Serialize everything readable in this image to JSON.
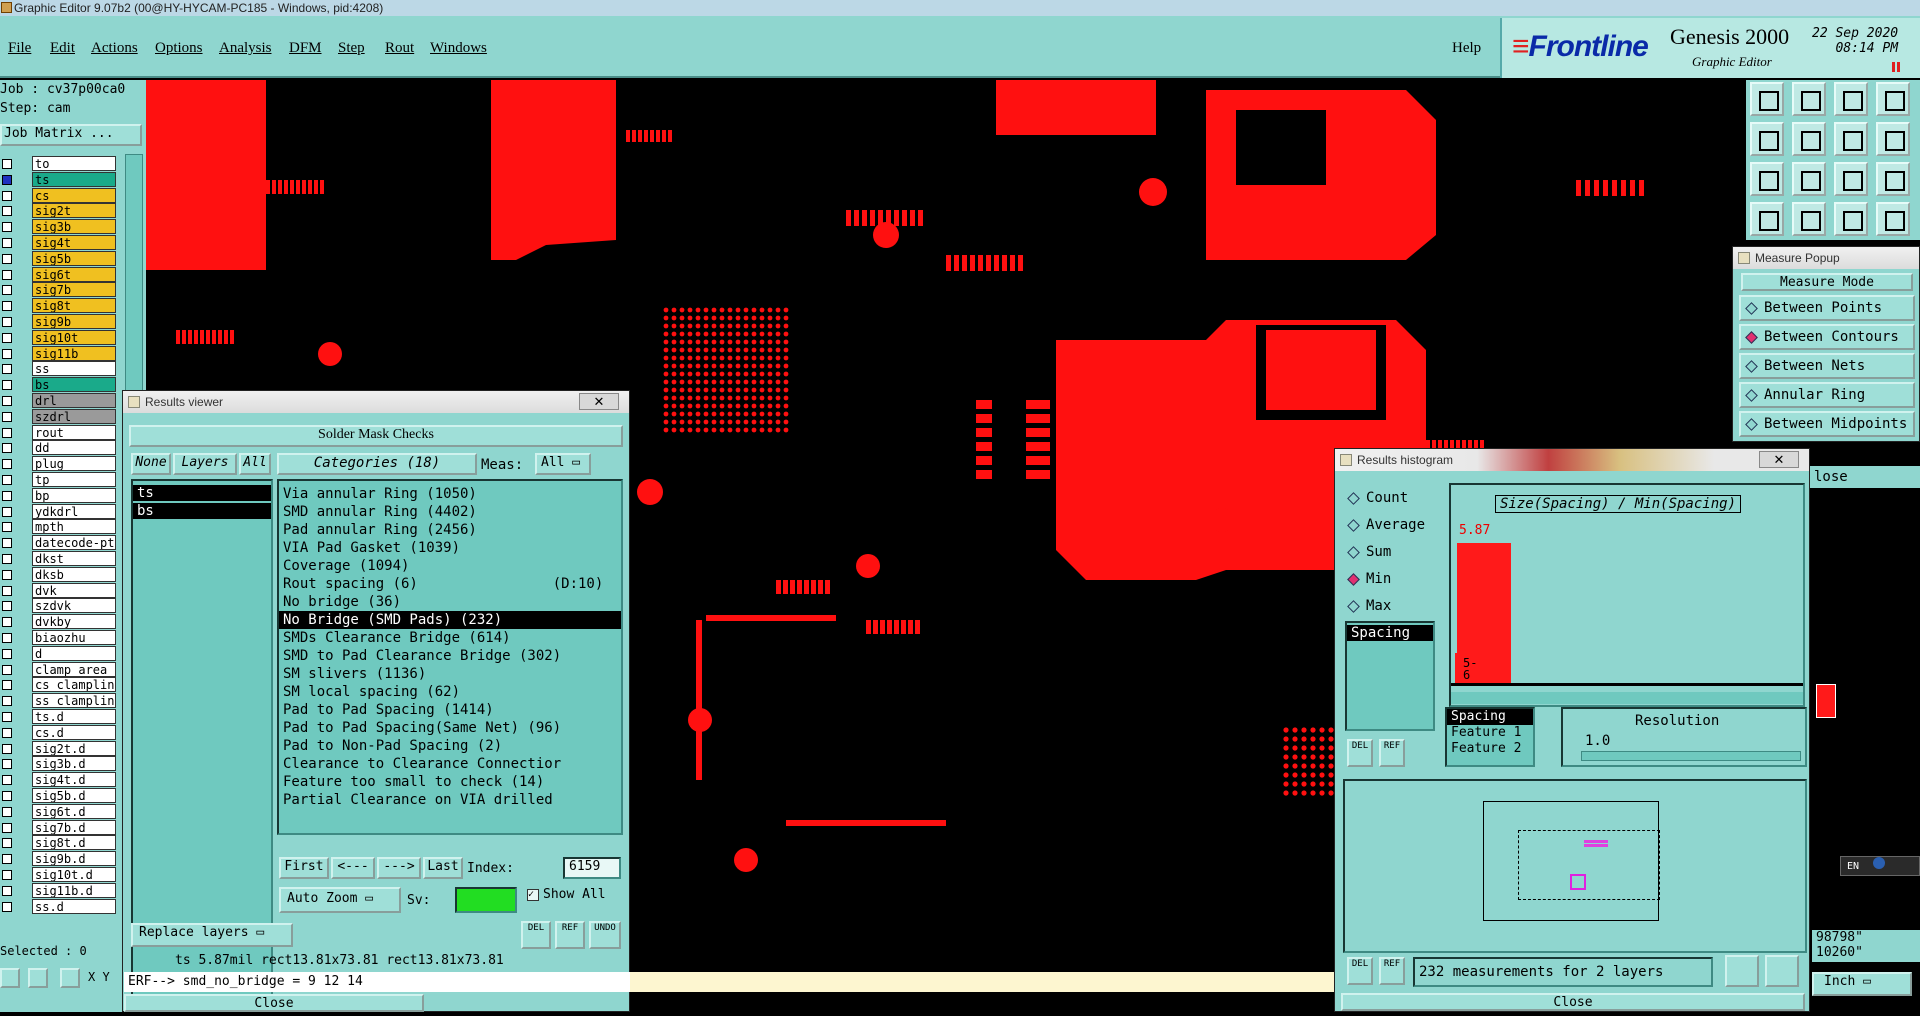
{
  "window": {
    "title": "Graphic Editor 9.07b2 (00@HY-HYCAM-PC185 - Windows, pid:4208)"
  },
  "menu": {
    "items": [
      "File",
      "Edit",
      "Actions",
      "Options",
      "Analysis",
      "DFM",
      "Step",
      "Rout",
      "Windows"
    ],
    "help": "Help"
  },
  "brand": {
    "logo": "Frontline",
    "product": "Genesis 2000",
    "subtitle": "Graphic Editor",
    "date": "22 Sep 2020",
    "time": "08:14 PM"
  },
  "job": {
    "job_line": "Job : cv37p00ca0",
    "step_line": "Step: cam",
    "matrix_button": "Job Matrix ..."
  },
  "layers": [
    {
      "name": "to",
      "color": "#ffffff"
    },
    {
      "name": "ts",
      "color": "#1aaa8a"
    },
    {
      "name": "cs",
      "color": "#f0c020"
    },
    {
      "name": "sig2t",
      "color": "#f0c020"
    },
    {
      "name": "sig3b",
      "color": "#f0c020"
    },
    {
      "name": "sig4t",
      "color": "#f0c020"
    },
    {
      "name": "sig5b",
      "color": "#f0c020"
    },
    {
      "name": "sig6t",
      "color": "#f0c020"
    },
    {
      "name": "sig7b",
      "color": "#f0c020"
    },
    {
      "name": "sig8t",
      "color": "#f0c020"
    },
    {
      "name": "sig9b",
      "color": "#f0c020"
    },
    {
      "name": "sig10t",
      "color": "#f0c020"
    },
    {
      "name": "sig11b",
      "color": "#f0c020"
    },
    {
      "name": "ss",
      "color": "#ffffff"
    },
    {
      "name": "bs",
      "color": "#1aaa8a"
    },
    {
      "name": "drl",
      "color": "#9a9a9a"
    },
    {
      "name": "szdrl",
      "color": "#9a9a9a"
    },
    {
      "name": "rout",
      "color": "#ffffff"
    },
    {
      "name": "dd",
      "color": "#ffffff"
    },
    {
      "name": "plug",
      "color": "#ffffff"
    },
    {
      "name": "tp",
      "color": "#ffffff"
    },
    {
      "name": "bp",
      "color": "#ffffff"
    },
    {
      "name": "ydkdrl",
      "color": "#ffffff"
    },
    {
      "name": "mpth",
      "color": "#ffffff"
    },
    {
      "name": "datecode-ptc",
      "color": "#ffffff"
    },
    {
      "name": "dkst",
      "color": "#ffffff"
    },
    {
      "name": "dksb",
      "color": "#ffffff"
    },
    {
      "name": "dvk",
      "color": "#ffffff"
    },
    {
      "name": "szdvk",
      "color": "#ffffff"
    },
    {
      "name": "dvkby",
      "color": "#ffffff"
    },
    {
      "name": "biaozhu",
      "color": "#ffffff"
    },
    {
      "name": "d",
      "color": "#ffffff"
    },
    {
      "name": "clamp_area",
      "color": "#ffffff"
    },
    {
      "name": "cs_clamplin",
      "color": "#ffffff"
    },
    {
      "name": "ss_clamplin",
      "color": "#ffffff"
    },
    {
      "name": "ts.d",
      "color": "#ffffff"
    },
    {
      "name": "cs.d",
      "color": "#ffffff"
    },
    {
      "name": "sig2t.d",
      "color": "#ffffff"
    },
    {
      "name": "sig3b.d",
      "color": "#ffffff"
    },
    {
      "name": "sig4t.d",
      "color": "#ffffff"
    },
    {
      "name": "sig5b.d",
      "color": "#ffffff"
    },
    {
      "name": "sig6t.d",
      "color": "#ffffff"
    },
    {
      "name": "sig7b.d",
      "color": "#ffffff"
    },
    {
      "name": "sig8t.d",
      "color": "#ffffff"
    },
    {
      "name": "sig9b.d",
      "color": "#ffffff"
    },
    {
      "name": "sig10t.d",
      "color": "#ffffff"
    },
    {
      "name": "sig11b.d",
      "color": "#ffffff"
    },
    {
      "name": "ss.d",
      "color": "#ffffff"
    }
  ],
  "selected": "Selected : 0",
  "xy_label": "X Y",
  "results_viewer": {
    "title": "Results viewer",
    "close_x": "✕",
    "header": "Solder Mask Checks",
    "none_btn": "None",
    "layers_label": "Layers",
    "all_btn": "All",
    "layer_items": [
      "ts",
      "bs"
    ],
    "categories_label": "Categories (18)",
    "meas_label": "Meas:",
    "meas_value": "All",
    "categories": [
      "Via annular Ring (1050)",
      "SMD annular Ring (4402)",
      "Pad annular Ring (2456)",
      "VIA Pad Gasket (1039)",
      "Coverage (1094)",
      "Rout spacing (6)                (D:10)",
      "No bridge (36)",
      "No Bridge (SMD Pads) (232)",
      "SMDs Clearance Bridge (614)",
      "SMD to Pad Clearance Bridge (302)",
      "SM slivers (1136)",
      "SM local spacing (62)",
      "Pad to Pad Spacing (1414)",
      "Pad to Pad Spacing(Same Net) (96)",
      "Pad to Non-Pad Spacing (2)",
      "Clearance to Clearance Connectior",
      "Feature too small to check (14)",
      "Partial Clearance on VIA drilled"
    ],
    "selected_index": 7,
    "nav": {
      "first": "First",
      "prev": "<---",
      "next": "--->",
      "last": "Last",
      "index_label": "Index:",
      "index_value": "6159"
    },
    "auto_zoom": "Auto Zoom",
    "sv_label": "Sv:",
    "show_all": "Show All",
    "replace_layers": "Replace layers",
    "del": "DEL",
    "ref": "REF",
    "undo": "UNDO",
    "status": "ts 5.87mil  rect13.81x73.81  rect13.81x73.81",
    "erf": "ERF--> smd_no_bridge = 9 12 14",
    "close": "Close"
  },
  "histogram": {
    "title": "Results histogram",
    "close_x": "✕",
    "modes": [
      {
        "label": "Count",
        "on": false
      },
      {
        "label": "Average",
        "on": false
      },
      {
        "label": "Sum",
        "on": false
      },
      {
        "label": "Min",
        "on": true
      },
      {
        "label": "Max",
        "on": false
      }
    ],
    "list_item": "Spacing",
    "chart_title": "Size(Spacing) / Min(Spacing)",
    "bar_value_label": "5.87",
    "bar_range_label": "5-\n6",
    "bar_fill": 1.0,
    "spacing_list": [
      "Spacing",
      "Feature 1",
      "Feature 2"
    ],
    "resolution_label": "Resolution",
    "resolution_value": "1.0",
    "footer": "232 measurements for 2 layers",
    "close": "Close"
  },
  "measure": {
    "title": "Measure Popup",
    "mode_label": "Measure Mode",
    "modes": [
      {
        "label": "Between Points",
        "on": false
      },
      {
        "label": "Between Contours",
        "on": true
      },
      {
        "label": "Between Nets",
        "on": false
      },
      {
        "label": "Annular Ring",
        "on": false
      },
      {
        "label": "Between Midpoints",
        "on": false
      }
    ],
    "close_partial": "lose"
  },
  "coords": {
    "x": "98798\"",
    "y": "10260\"",
    "unit": "Inch"
  },
  "lang": "EN",
  "colors": {
    "panel": "#8fd6cf",
    "pcb": "#ff1010",
    "selected": "#000000"
  }
}
